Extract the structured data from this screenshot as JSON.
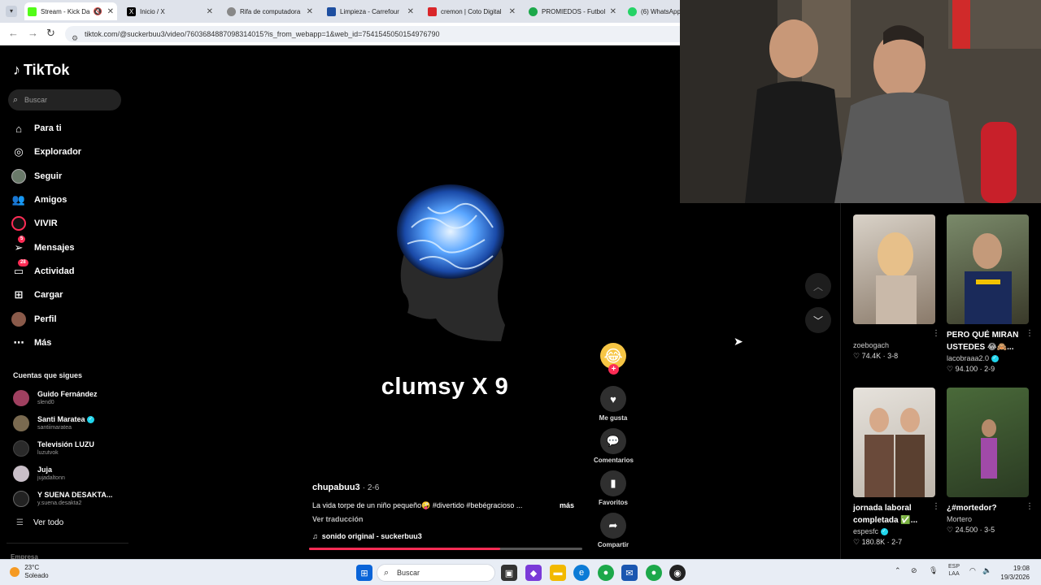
{
  "browser": {
    "tabs": [
      {
        "title": "Stream - Kick Da",
        "color": "#53fc18"
      },
      {
        "title": "Inicio / X",
        "color": "#000000"
      },
      {
        "title": "Rifa de computadora",
        "color": "#888888"
      },
      {
        "title": "Limpieza - Carrefour",
        "color": "#1e4fa0"
      },
      {
        "title": "cremon | Coto Digital",
        "color": "#d9262a"
      },
      {
        "title": "PROMIEDOS - Futbol",
        "color": "#1ca84a"
      },
      {
        "title": "(6) WhatsApp",
        "color": "#25d366"
      }
    ],
    "url": "tiktok.com/@suckerbuu3/video/7603684887098314015?is_from_webapp=1&web_id=7541545050154976790"
  },
  "sidebar": {
    "logo": "TikTok",
    "search_placeholder": "Buscar",
    "menu": [
      {
        "label": "Para ti",
        "icon": "home-icon"
      },
      {
        "label": "Explorador",
        "icon": "compass-icon"
      },
      {
        "label": "Seguir",
        "icon": "following-avatar-icon"
      },
      {
        "label": "Amigos",
        "icon": "friends-icon"
      },
      {
        "label": "VIVIR",
        "icon": "live-icon"
      },
      {
        "label": "Mensajes",
        "icon": "messages-icon",
        "badge": "5"
      },
      {
        "label": "Actividad",
        "icon": "activity-icon",
        "badge": "28"
      },
      {
        "label": "Cargar",
        "icon": "upload-icon"
      },
      {
        "label": "Perfil",
        "icon": "profile-avatar-icon"
      },
      {
        "label": "Más",
        "icon": "more-icon"
      }
    ],
    "following_header": "Cuentas que sigues",
    "following": [
      {
        "name": "Guido Fernández",
        "user": "slend0",
        "verified": false
      },
      {
        "name": "Santi Maratea",
        "user": "santiimaratea",
        "verified": true
      },
      {
        "name": "Televisión LUZU",
        "user": "luzutvok",
        "verified": false
      },
      {
        "name": "Juja",
        "user": "jujadaltonn",
        "verified": false
      },
      {
        "name": "Y SUENA DESAKTA...",
        "user": "y.suena.desakta2",
        "verified": false
      }
    ],
    "see_all": "Ver todo",
    "footer_label": "Empresa"
  },
  "video": {
    "overlay_text": "clumsy X 9",
    "author": "chupabuu3",
    "date": "2-6",
    "description": "La vida torpe de un niño pequeño🤪 #divertido #bebégracioso ...",
    "more": "más",
    "translate": "Ver traducción",
    "sound": "sonido original - suckerbuu3",
    "progress": 0.7
  },
  "actions": {
    "like": "Me gusta",
    "comments": "Comentarios",
    "favorites": "Favoritos",
    "share": "Compartir"
  },
  "recommendations": [
    {
      "title": "",
      "user": "zoebogach",
      "verified": false,
      "likes": "74.4K",
      "date": "3-8"
    },
    {
      "title": "PERO QUÉ MIRAN USTEDES 😂🙈...",
      "user": "lacobraaa2.0",
      "verified": true,
      "likes": "94.100",
      "date": "2-9"
    },
    {
      "title": "jornada laboral completada ✅...",
      "user": "espesfc",
      "verified": true,
      "likes": "180.8K",
      "date": "2-7"
    },
    {
      "title": "¿#mortedor?",
      "user": "Mortero",
      "verified": false,
      "likes": "24.500",
      "date": "3-5"
    }
  ],
  "taskbar": {
    "weather_temp": "23°C",
    "weather_desc": "Soleado",
    "search": "Buscar",
    "lang": "ESP",
    "lang2": "LAA",
    "time": "19:08",
    "date": "19/3/2026"
  }
}
